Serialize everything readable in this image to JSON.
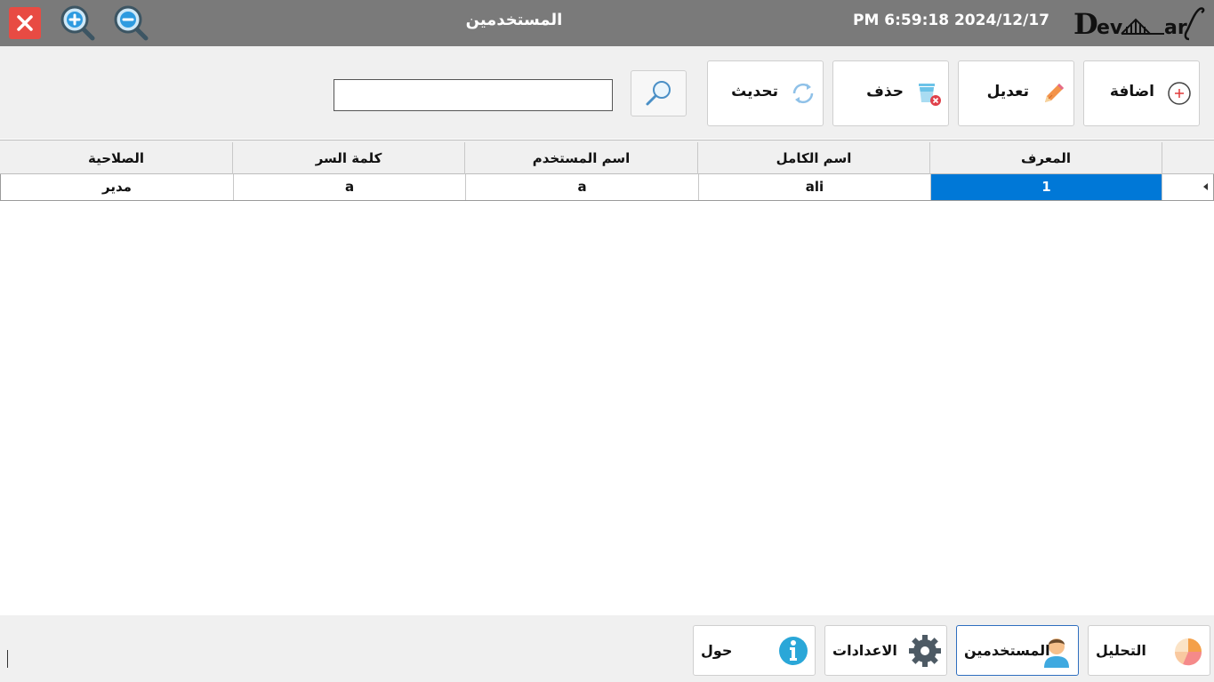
{
  "window": {
    "title": "المستخدمين",
    "datetime": "PM 6:59:18 2024/12/17",
    "logo_text": "DevMarf"
  },
  "toolbar": {
    "add_label": "اضافة",
    "edit_label": "تعديل",
    "delete_label": "حذف",
    "refresh_label": "تحديث",
    "search_value": ""
  },
  "grid": {
    "columns": [
      "المعرف",
      "اسم الكامل",
      "اسم المستخدم",
      "كلمة السر",
      "الصلاحية"
    ],
    "rows": [
      [
        "1",
        "ali",
        "a",
        "a",
        "مدير"
      ]
    ]
  },
  "nav": {
    "analysis_label": "التحليل",
    "users_label": "المستخدمين",
    "settings_label": "الاعدادات",
    "about_label": "حول"
  },
  "colors": {
    "topbar": "#7a7a7a",
    "close": "#e84b43",
    "selection": "#0078d7"
  }
}
